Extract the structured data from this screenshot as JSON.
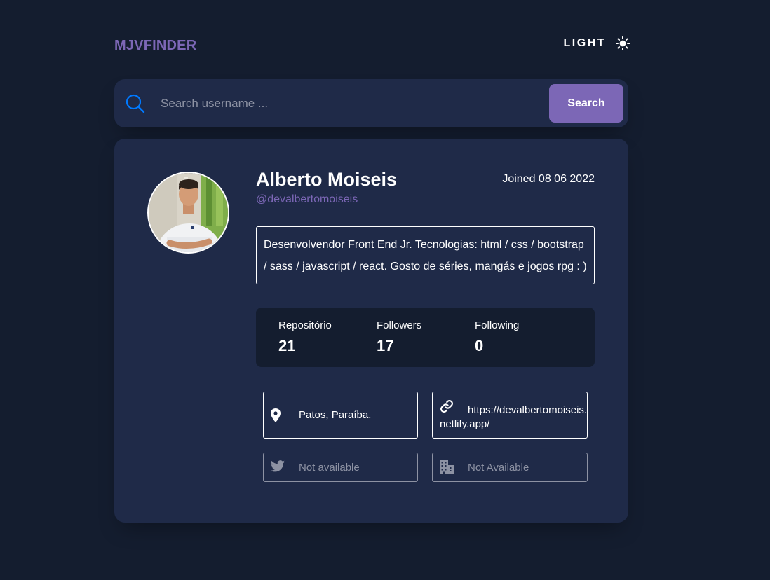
{
  "header": {
    "logo": "MJVFINDER",
    "theme_label": "LIGHT",
    "theme_icon": "sun-icon"
  },
  "search": {
    "placeholder": "Search username ...",
    "value": "",
    "button_label": "Search",
    "icon": "search-icon"
  },
  "profile": {
    "name": "Alberto Moiseis",
    "handle": "@devalbertomoiseis",
    "joined": "Joined 08 06 2022",
    "bio": "Desenvolvendor Front End Jr. Tecnologias: html / css / bootstrap / sass / javascript / react. Gosto de séries, mangás e jogos rpg : )",
    "stats": [
      {
        "label": "Repositório",
        "value": "21"
      },
      {
        "label": "Followers",
        "value": "17"
      },
      {
        "label": "Following",
        "value": "0"
      }
    ],
    "links": {
      "location": {
        "icon": "location-pin-icon",
        "text": "Patos, Paraíba."
      },
      "website": {
        "icon": "link-icon",
        "text": "https://devalbertomoiseis.netlify.app/"
      },
      "twitter": {
        "icon": "twitter-icon",
        "text": "Not available"
      },
      "company": {
        "icon": "building-icon",
        "text": "Not Available"
      }
    }
  },
  "colors": {
    "background": "#141d2f",
    "card": "#1f2a48",
    "accent": "#7c67b6",
    "search_icon": "#0079ff",
    "muted": "#8d92a3",
    "text": "#ffffff"
  }
}
